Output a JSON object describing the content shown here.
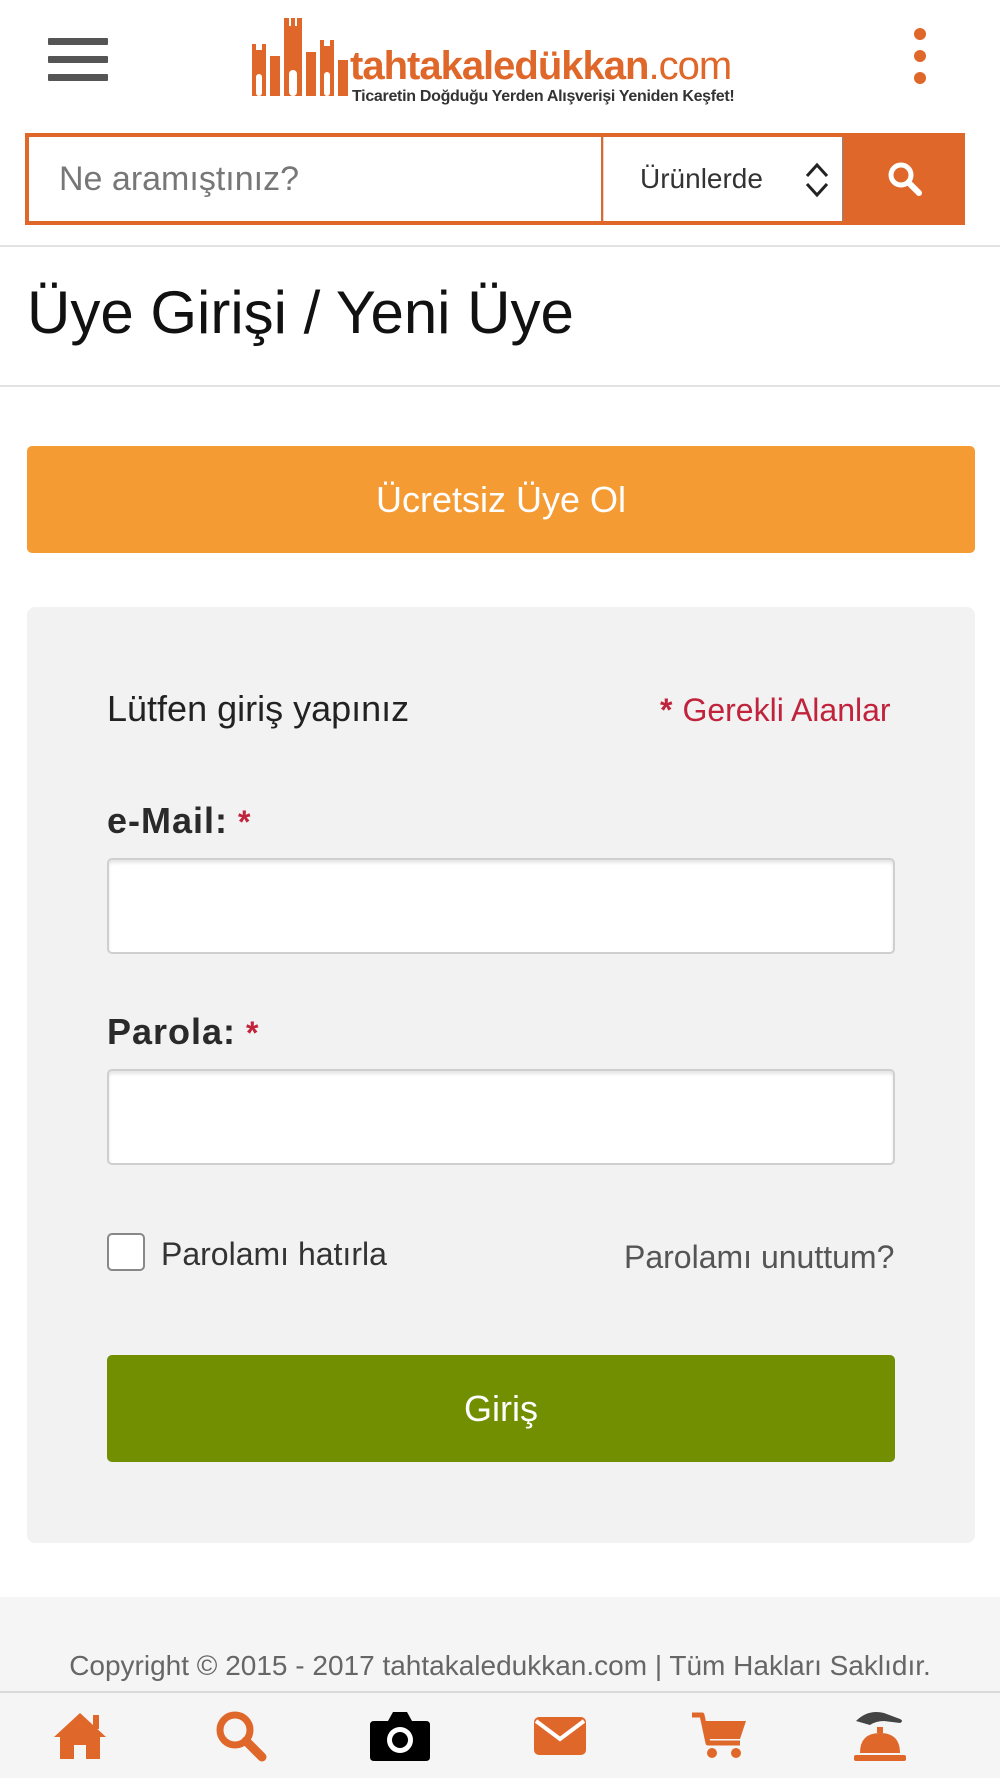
{
  "header": {
    "menu_icon": "hamburger-menu-icon",
    "logo": {
      "name": "tahtakaledükkan",
      "tld": ".com",
      "tagline": "Ticaretin Doğduğu Yerden Alışverişi Yeniden Keşfet!"
    },
    "overflow_icon": "vertical-dots-icon"
  },
  "search": {
    "placeholder": "Ne aramıştınız?",
    "scope_selected": "Ürünlerde",
    "button_icon": "search-icon"
  },
  "page": {
    "title": "Üye Girişi / Yeni Üye"
  },
  "register": {
    "label": "Ücretsiz Üye Ol"
  },
  "login_form": {
    "heading": "Lütfen giriş yapınız",
    "required_star": "*",
    "required_note": "Gerekli Alanlar",
    "email_label": "e-Mail:",
    "password_label": "Parola:",
    "field_required_star": "*",
    "email_value": "",
    "password_value": "",
    "remember_label": "Parolamı hatırla",
    "remember_checked": false,
    "forgot_link": "Parolamı unuttum?",
    "submit_label": "Giriş"
  },
  "footer": {
    "copyright": "Copyright © 2015 - 2017 tahtakaledukkan.com | Tüm Hakları Saklıdır."
  },
  "bottom_nav": {
    "items": [
      {
        "icon": "home-icon",
        "color": "#e0672a"
      },
      {
        "icon": "search-icon",
        "color": "#e0672a"
      },
      {
        "icon": "camera-icon",
        "color": "#000000"
      },
      {
        "icon": "envelope-icon",
        "color": "#e0672a"
      },
      {
        "icon": "cart-icon",
        "color": "#e0672a"
      },
      {
        "icon": "service-bell-icon",
        "color": "#e0672a"
      }
    ]
  },
  "colors": {
    "brand_orange": "#e0672a",
    "register_orange": "#f59b33",
    "login_green": "#718f00",
    "required_red": "#c0233b"
  }
}
